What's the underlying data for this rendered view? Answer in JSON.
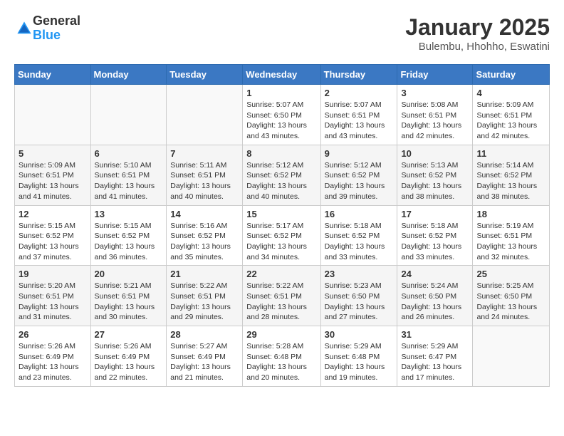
{
  "header": {
    "logo_general": "General",
    "logo_blue": "Blue",
    "month_title": "January 2025",
    "location": "Bulembu, Hhohho, Eswatini"
  },
  "days_of_week": [
    "Sunday",
    "Monday",
    "Tuesday",
    "Wednesday",
    "Thursday",
    "Friday",
    "Saturday"
  ],
  "weeks": [
    [
      {
        "day": "",
        "sunrise": "",
        "sunset": "",
        "daylight": ""
      },
      {
        "day": "",
        "sunrise": "",
        "sunset": "",
        "daylight": ""
      },
      {
        "day": "",
        "sunrise": "",
        "sunset": "",
        "daylight": ""
      },
      {
        "day": "1",
        "sunrise": "Sunrise: 5:07 AM",
        "sunset": "Sunset: 6:50 PM",
        "daylight": "Daylight: 13 hours and 43 minutes."
      },
      {
        "day": "2",
        "sunrise": "Sunrise: 5:07 AM",
        "sunset": "Sunset: 6:51 PM",
        "daylight": "Daylight: 13 hours and 43 minutes."
      },
      {
        "day": "3",
        "sunrise": "Sunrise: 5:08 AM",
        "sunset": "Sunset: 6:51 PM",
        "daylight": "Daylight: 13 hours and 42 minutes."
      },
      {
        "day": "4",
        "sunrise": "Sunrise: 5:09 AM",
        "sunset": "Sunset: 6:51 PM",
        "daylight": "Daylight: 13 hours and 42 minutes."
      }
    ],
    [
      {
        "day": "5",
        "sunrise": "Sunrise: 5:09 AM",
        "sunset": "Sunset: 6:51 PM",
        "daylight": "Daylight: 13 hours and 41 minutes."
      },
      {
        "day": "6",
        "sunrise": "Sunrise: 5:10 AM",
        "sunset": "Sunset: 6:51 PM",
        "daylight": "Daylight: 13 hours and 41 minutes."
      },
      {
        "day": "7",
        "sunrise": "Sunrise: 5:11 AM",
        "sunset": "Sunset: 6:51 PM",
        "daylight": "Daylight: 13 hours and 40 minutes."
      },
      {
        "day": "8",
        "sunrise": "Sunrise: 5:12 AM",
        "sunset": "Sunset: 6:52 PM",
        "daylight": "Daylight: 13 hours and 40 minutes."
      },
      {
        "day": "9",
        "sunrise": "Sunrise: 5:12 AM",
        "sunset": "Sunset: 6:52 PM",
        "daylight": "Daylight: 13 hours and 39 minutes."
      },
      {
        "day": "10",
        "sunrise": "Sunrise: 5:13 AM",
        "sunset": "Sunset: 6:52 PM",
        "daylight": "Daylight: 13 hours and 38 minutes."
      },
      {
        "day": "11",
        "sunrise": "Sunrise: 5:14 AM",
        "sunset": "Sunset: 6:52 PM",
        "daylight": "Daylight: 13 hours and 38 minutes."
      }
    ],
    [
      {
        "day": "12",
        "sunrise": "Sunrise: 5:15 AM",
        "sunset": "Sunset: 6:52 PM",
        "daylight": "Daylight: 13 hours and 37 minutes."
      },
      {
        "day": "13",
        "sunrise": "Sunrise: 5:15 AM",
        "sunset": "Sunset: 6:52 PM",
        "daylight": "Daylight: 13 hours and 36 minutes."
      },
      {
        "day": "14",
        "sunrise": "Sunrise: 5:16 AM",
        "sunset": "Sunset: 6:52 PM",
        "daylight": "Daylight: 13 hours and 35 minutes."
      },
      {
        "day": "15",
        "sunrise": "Sunrise: 5:17 AM",
        "sunset": "Sunset: 6:52 PM",
        "daylight": "Daylight: 13 hours and 34 minutes."
      },
      {
        "day": "16",
        "sunrise": "Sunrise: 5:18 AM",
        "sunset": "Sunset: 6:52 PM",
        "daylight": "Daylight: 13 hours and 33 minutes."
      },
      {
        "day": "17",
        "sunrise": "Sunrise: 5:18 AM",
        "sunset": "Sunset: 6:52 PM",
        "daylight": "Daylight: 13 hours and 33 minutes."
      },
      {
        "day": "18",
        "sunrise": "Sunrise: 5:19 AM",
        "sunset": "Sunset: 6:51 PM",
        "daylight": "Daylight: 13 hours and 32 minutes."
      }
    ],
    [
      {
        "day": "19",
        "sunrise": "Sunrise: 5:20 AM",
        "sunset": "Sunset: 6:51 PM",
        "daylight": "Daylight: 13 hours and 31 minutes."
      },
      {
        "day": "20",
        "sunrise": "Sunrise: 5:21 AM",
        "sunset": "Sunset: 6:51 PM",
        "daylight": "Daylight: 13 hours and 30 minutes."
      },
      {
        "day": "21",
        "sunrise": "Sunrise: 5:22 AM",
        "sunset": "Sunset: 6:51 PM",
        "daylight": "Daylight: 13 hours and 29 minutes."
      },
      {
        "day": "22",
        "sunrise": "Sunrise: 5:22 AM",
        "sunset": "Sunset: 6:51 PM",
        "daylight": "Daylight: 13 hours and 28 minutes."
      },
      {
        "day": "23",
        "sunrise": "Sunrise: 5:23 AM",
        "sunset": "Sunset: 6:50 PM",
        "daylight": "Daylight: 13 hours and 27 minutes."
      },
      {
        "day": "24",
        "sunrise": "Sunrise: 5:24 AM",
        "sunset": "Sunset: 6:50 PM",
        "daylight": "Daylight: 13 hours and 26 minutes."
      },
      {
        "day": "25",
        "sunrise": "Sunrise: 5:25 AM",
        "sunset": "Sunset: 6:50 PM",
        "daylight": "Daylight: 13 hours and 24 minutes."
      }
    ],
    [
      {
        "day": "26",
        "sunrise": "Sunrise: 5:26 AM",
        "sunset": "Sunset: 6:49 PM",
        "daylight": "Daylight: 13 hours and 23 minutes."
      },
      {
        "day": "27",
        "sunrise": "Sunrise: 5:26 AM",
        "sunset": "Sunset: 6:49 PM",
        "daylight": "Daylight: 13 hours and 22 minutes."
      },
      {
        "day": "28",
        "sunrise": "Sunrise: 5:27 AM",
        "sunset": "Sunset: 6:49 PM",
        "daylight": "Daylight: 13 hours and 21 minutes."
      },
      {
        "day": "29",
        "sunrise": "Sunrise: 5:28 AM",
        "sunset": "Sunset: 6:48 PM",
        "daylight": "Daylight: 13 hours and 20 minutes."
      },
      {
        "day": "30",
        "sunrise": "Sunrise: 5:29 AM",
        "sunset": "Sunset: 6:48 PM",
        "daylight": "Daylight: 13 hours and 19 minutes."
      },
      {
        "day": "31",
        "sunrise": "Sunrise: 5:29 AM",
        "sunset": "Sunset: 6:47 PM",
        "daylight": "Daylight: 13 hours and 17 minutes."
      },
      {
        "day": "",
        "sunrise": "",
        "sunset": "",
        "daylight": ""
      }
    ]
  ]
}
